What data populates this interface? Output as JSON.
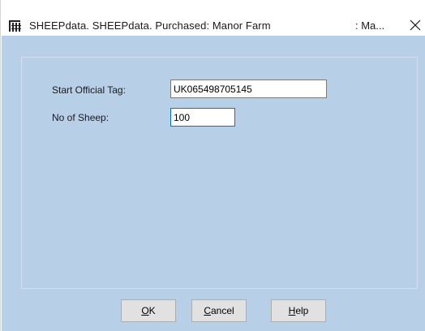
{
  "window": {
    "title": "SHEEPdata. SHEEPdata. Purchased: Manor Farm",
    "title_right": ": Ma...",
    "close_glyph": "✕"
  },
  "form": {
    "start_tag_label": "Start Official Tag:",
    "start_tag_value": "UK065498705145",
    "no_sheep_label": "No of Sheep:",
    "no_sheep_value": "100"
  },
  "buttons": {
    "ok": {
      "mnemonic": "O",
      "rest": "K"
    },
    "cancel": {
      "mnemonic": "C",
      "rest": "ancel"
    },
    "help": {
      "mnemonic": "H",
      "rest": "elp"
    }
  },
  "colors": {
    "client_background": "#b8cfe8",
    "focus_border": "#0078d7"
  },
  "icons": {
    "app_icon": "sheepdata-app-icon",
    "close_icon": "close-icon"
  }
}
